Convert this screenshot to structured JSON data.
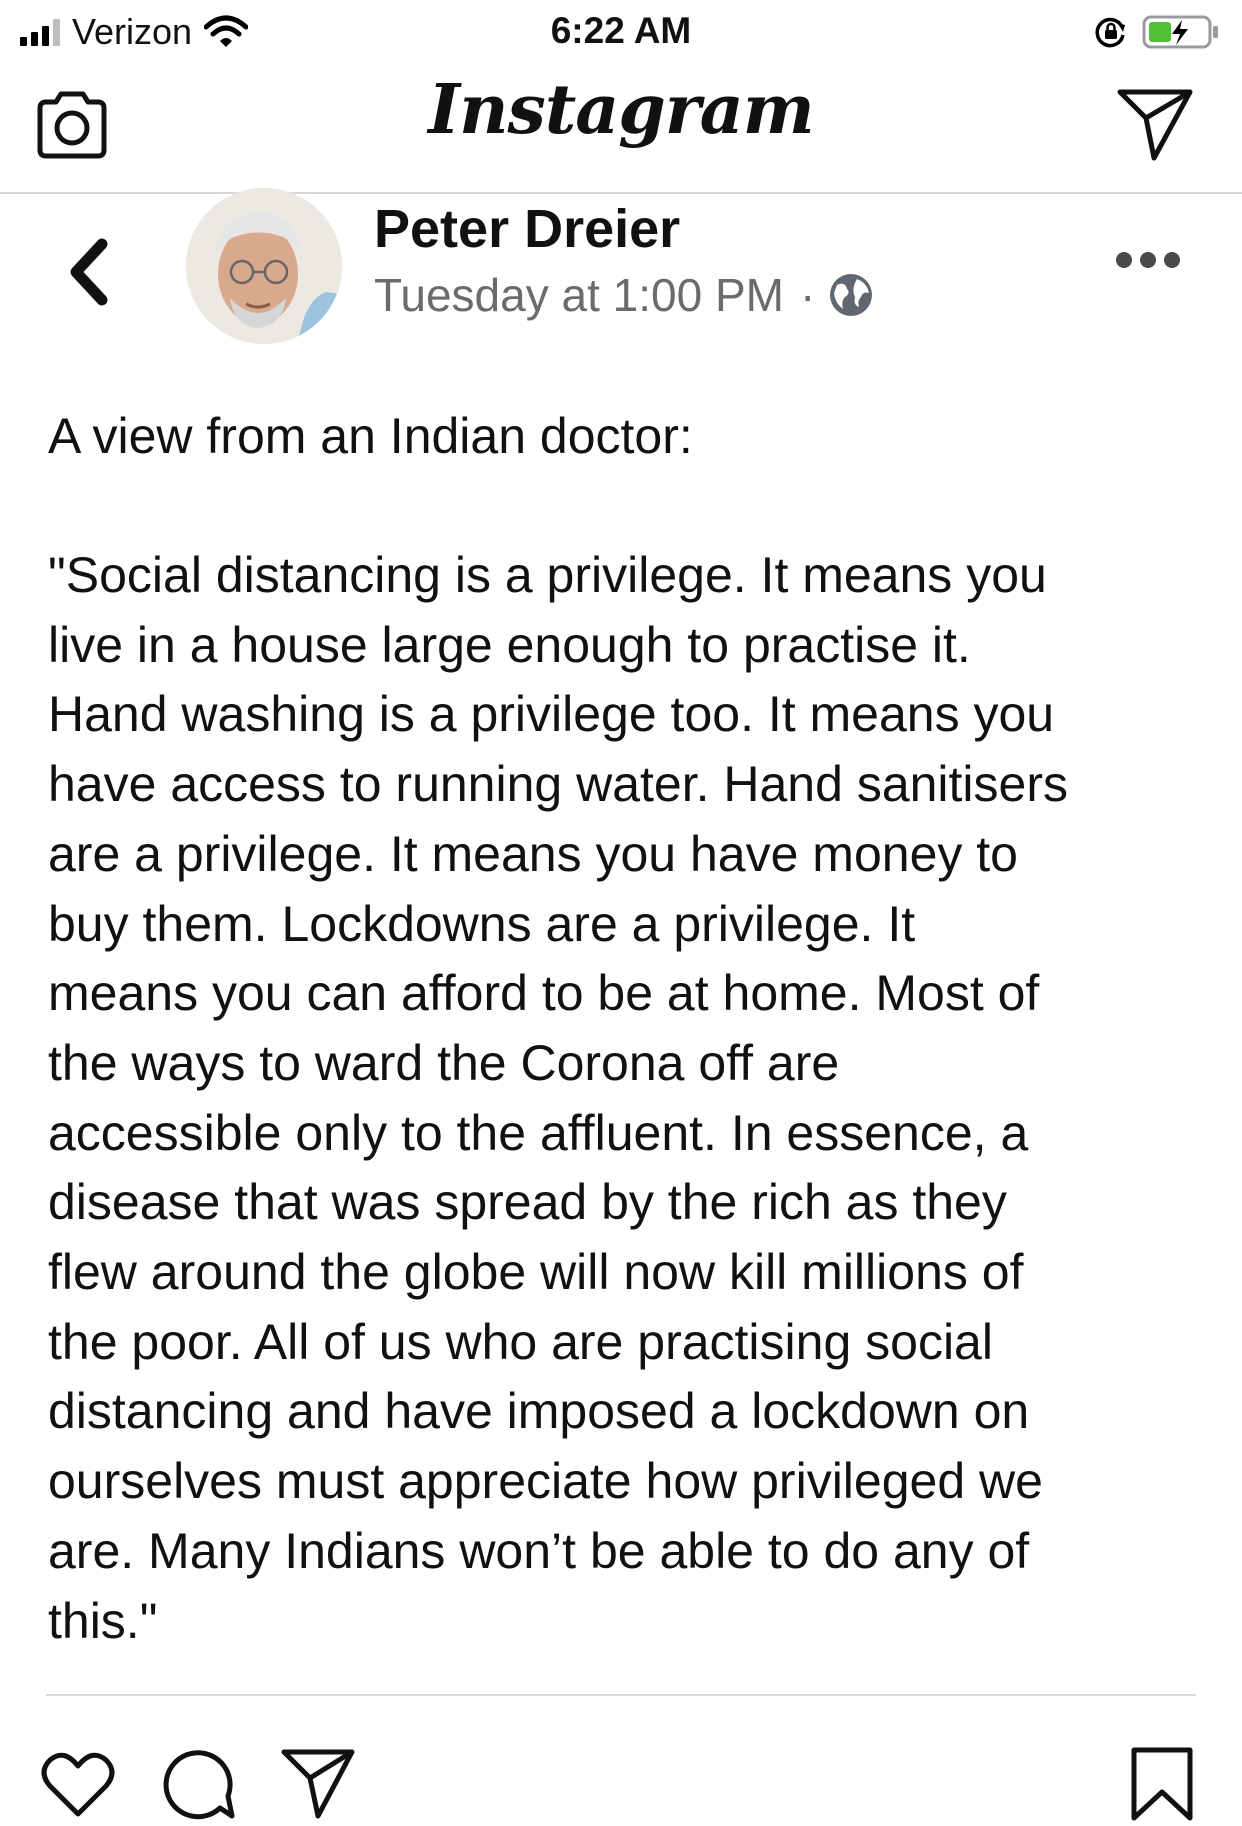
{
  "status_bar": {
    "carrier": "Verizon",
    "time": "6:22 AM",
    "icons": [
      "signal-icon",
      "wifi-icon",
      "orientation-lock-icon",
      "battery-charging-icon"
    ]
  },
  "app_header": {
    "logo": "Instagram",
    "left_icon": "camera-icon",
    "right_icon": "direct-message-icon"
  },
  "post": {
    "author": "Peter Dreier",
    "timestamp": "Tuesday at 1:00 PM",
    "separator": "·",
    "privacy_icon": "globe-icon",
    "intro": "A view from an Indian doctor:",
    "body_lines": [
      "\"Social distancing is a privilege. It means you",
      "live in a house large enough to practise it.",
      "Hand washing is a privilege too. It means you",
      "have access to running water. Hand sanitisers",
      "are a privilege. It means you have money to",
      "buy them. Lockdowns are a privilege. It",
      "means you can afford to be at home. Most of",
      "the ways to ward the Corona off are",
      "accessible only to the affluent. In essence, a",
      "disease that was spread by the rich as they",
      "flew around the globe will now kill millions of",
      "the poor. All of us who are practising social",
      "distancing and have imposed a lockdown on",
      "ourselves must appreciate how privileged we",
      "are. Many Indians won’t be able to do any of",
      "this.\""
    ]
  },
  "action_bar": {
    "icons": [
      "heart-icon",
      "comment-icon",
      "share-icon",
      "bookmark-icon"
    ]
  },
  "colors": {
    "background": "#ffffff",
    "text": "#111111",
    "meta_text": "#6b6b6b",
    "divider": "#d6d6d6"
  }
}
